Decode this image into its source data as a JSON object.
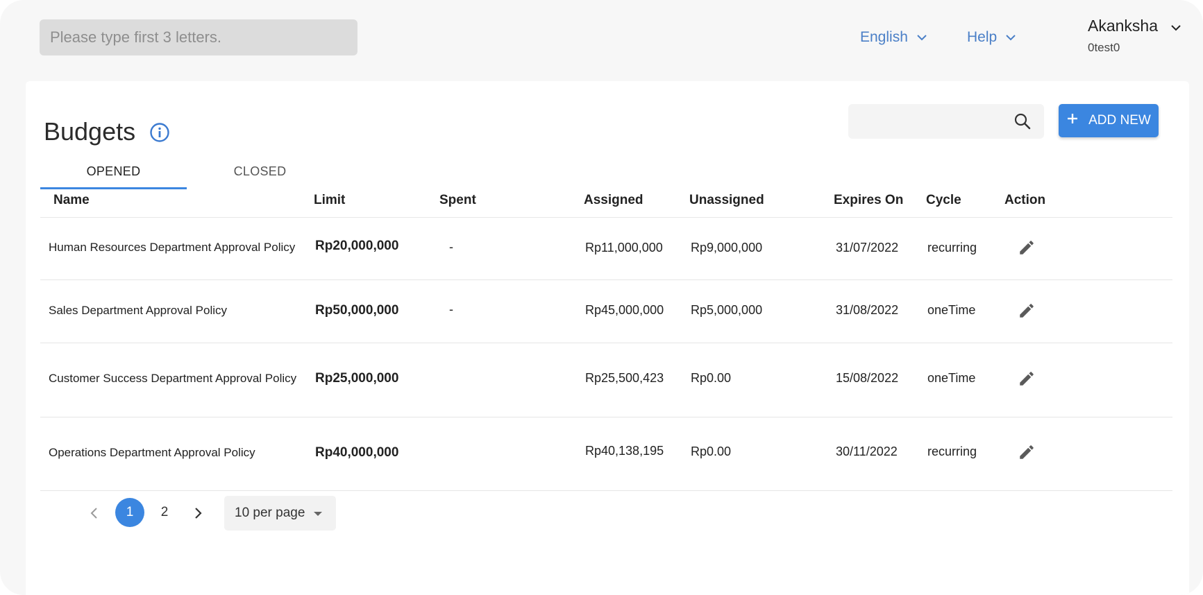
{
  "header": {
    "search_placeholder": "Please type first 3 letters.",
    "language_label": "English",
    "help_label": "Help",
    "user_name": "Akanksha",
    "user_sub": "0test0"
  },
  "page": {
    "title": "Budgets",
    "add_button_label": "ADD NEW",
    "accent_color": "#3b86e0"
  },
  "tabs": [
    {
      "label": "OPENED",
      "active": true
    },
    {
      "label": "CLOSED",
      "active": false
    }
  ],
  "table": {
    "columns": [
      "Name",
      "Limit",
      "Spent",
      "Assigned",
      "Unassigned",
      "Expires On",
      "Cycle",
      "Action"
    ],
    "rows": [
      {
        "name": "Human Resources Department Approval Policy",
        "limit": "Rp20,000,000",
        "spent": "-",
        "assigned": "Rp11,000,000",
        "unassigned": "Rp9,000,000",
        "expires": "31/07/2022",
        "cycle": "recurring",
        "action_icon": "pencil-icon"
      },
      {
        "name": "Sales Department Approval Policy",
        "limit": "Rp50,000,000",
        "spent": "-",
        "assigned": "Rp45,000,000",
        "unassigned": "Rp5,000,000",
        "expires": "31/08/2022",
        "cycle": "oneTime",
        "action_icon": "pencil-icon"
      },
      {
        "name": "Customer Success Department Approval Policy",
        "limit": "Rp25,000,000",
        "spent": "",
        "assigned": "Rp25,500,423",
        "unassigned": "Rp0.00",
        "expires": "15/08/2022",
        "cycle": "oneTime",
        "action_icon": "pencil-icon"
      },
      {
        "name": "Operations Department Approval Policy",
        "limit": "Rp40,000,000",
        "spent": "",
        "assigned": "Rp40,138,195",
        "unassigned": "Rp0.00",
        "expires": "30/11/2022",
        "cycle": "recurring",
        "action_icon": "pencil-icon"
      }
    ]
  },
  "pagination": {
    "pages": [
      "1",
      "2"
    ],
    "current_page": "1",
    "per_page_label": "10 per page"
  }
}
